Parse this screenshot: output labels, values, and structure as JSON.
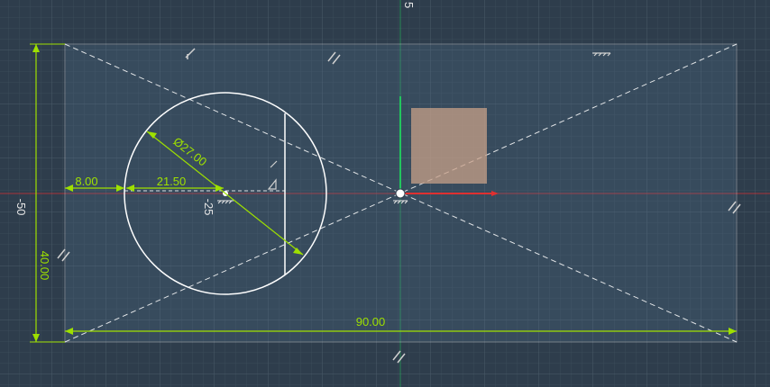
{
  "viewport": {
    "axis_labels": {
      "top_y": "5",
      "left_x": "-50",
      "below_center": "-25"
    }
  },
  "sketch": {
    "dimensions": {
      "width": "90.00",
      "height": "40.00",
      "circle_diameter": "Ø27.00",
      "circle_offset_x": "21.50",
      "rect_to_circle": "8.00"
    }
  },
  "colors": {
    "background": "#2e3d4c",
    "grid_minor": "#3a4a59",
    "grid_major": "#4a5a69",
    "sketch_line": "#ffffff",
    "dimension": "#9ee000",
    "x_axis": "#e03030",
    "y_axis": "#22c55e",
    "selection_fill": "#c8a088"
  },
  "icons": {
    "origin": "origin-point-icon",
    "constraints": [
      "horizontal-constraint-icon",
      "parallel-constraint-icon",
      "fix-constraint-icon"
    ]
  }
}
